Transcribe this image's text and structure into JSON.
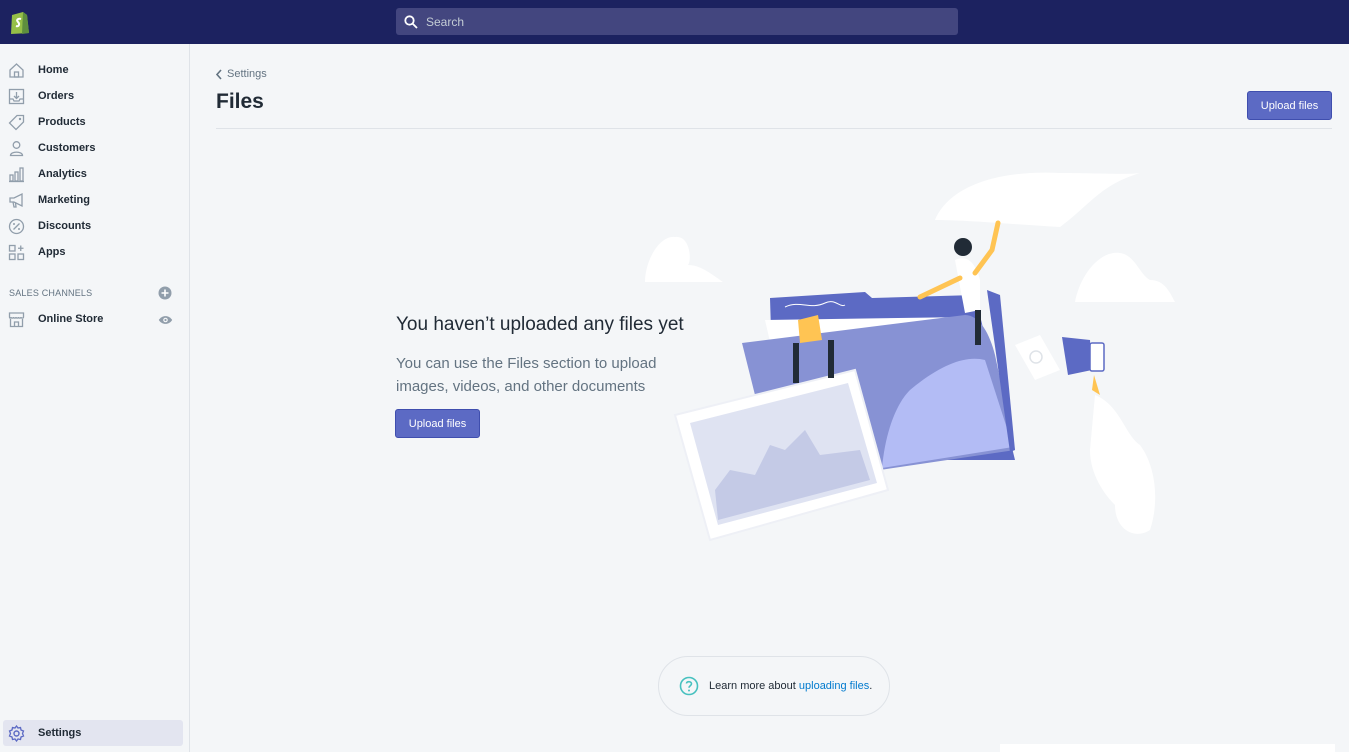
{
  "topbar": {
    "search_placeholder": "Search"
  },
  "sidebar": {
    "items": [
      {
        "label": "Home",
        "icon": "home-icon"
      },
      {
        "label": "Orders",
        "icon": "orders-icon"
      },
      {
        "label": "Products",
        "icon": "tag-icon"
      },
      {
        "label": "Customers",
        "icon": "person-icon"
      },
      {
        "label": "Analytics",
        "icon": "chart-icon"
      },
      {
        "label": "Marketing",
        "icon": "megaphone-icon"
      },
      {
        "label": "Discounts",
        "icon": "discount-icon"
      },
      {
        "label": "Apps",
        "icon": "apps-icon"
      }
    ],
    "sales_channels_heading": "SALES CHANNELS",
    "online_store_label": "Online Store",
    "settings_label": "Settings"
  },
  "main": {
    "breadcrumb": "Settings",
    "title": "Files",
    "upload_button": "Upload files",
    "empty_state": {
      "heading": "You haven’t uploaded any files yet",
      "description": "You can use the Files section to upload images, videos, and other documents",
      "button": "Upload files"
    },
    "footer": {
      "text": "Learn more about ",
      "link": "uploading files",
      "suffix": "."
    }
  },
  "colors": {
    "topbar": "#1c2260",
    "primary_button": "#5c6ac4",
    "link": "#007ace",
    "help_icon": "#47c1bf"
  }
}
